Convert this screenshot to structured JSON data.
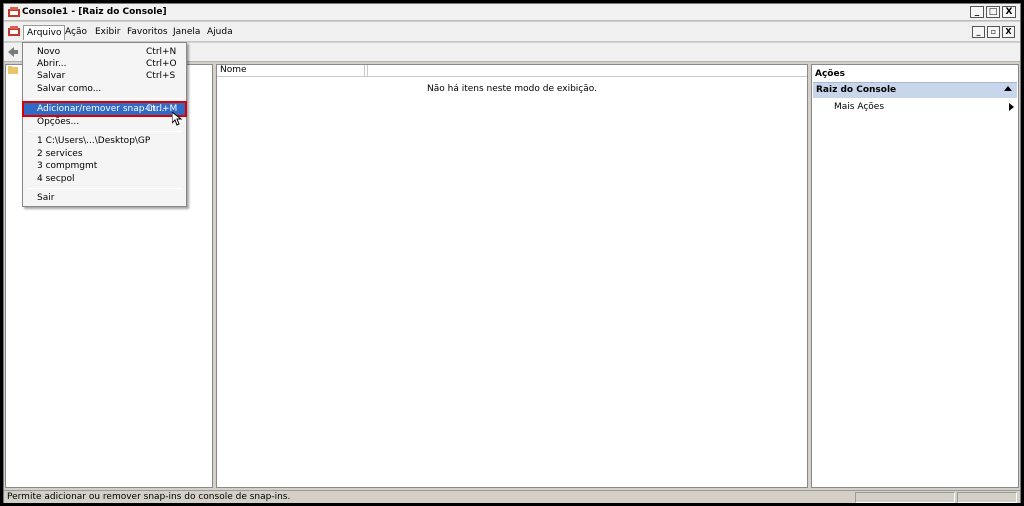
{
  "window": {
    "title": "Console1 - [Raiz do Console]",
    "controls": {
      "minimize": "_",
      "maximize": "□",
      "close": "X"
    }
  },
  "menubar": {
    "items": [
      "Arquivo",
      "Ação",
      "Exibir",
      "Favoritos",
      "Janela",
      "Ajuda"
    ],
    "mdi_controls": {
      "minimize": "_",
      "restore": "▫",
      "close": "X"
    }
  },
  "file_menu": {
    "items": [
      {
        "label": "Novo",
        "shortcut": "Ctrl+N"
      },
      {
        "label": "Abrir...",
        "shortcut": "Ctrl+O"
      },
      {
        "label": "Salvar",
        "shortcut": "Ctrl+S"
      },
      {
        "label": "Salvar como...",
        "shortcut": ""
      },
      {
        "label": "Adicionar/remover snap-in...",
        "shortcut": "Ctrl+M",
        "highlighted": true
      },
      {
        "label": "Opções...",
        "shortcut": ""
      },
      {
        "label": "1 C:\\Users\\...\\Desktop\\GP",
        "shortcut": ""
      },
      {
        "label": "2 services",
        "shortcut": ""
      },
      {
        "label": "3 compmgmt",
        "shortcut": ""
      },
      {
        "label": "4 secpol",
        "shortcut": ""
      },
      {
        "label": "Sair",
        "shortcut": ""
      }
    ]
  },
  "list_pane": {
    "column_header": "Nome",
    "empty_message": "Não há itens neste modo de exibição."
  },
  "actions_pane": {
    "title": "Ações",
    "group": "Raiz do Console",
    "item": "Mais Ações"
  },
  "statusbar": {
    "text": "Permite adicionar ou remover snap-ins do console de snap-ins."
  },
  "colors": {
    "highlight": "#316ac5",
    "highlight_outline": "#d80000",
    "actions_group_bg": "#c8d6ec",
    "chrome": "#d4d0c8"
  }
}
